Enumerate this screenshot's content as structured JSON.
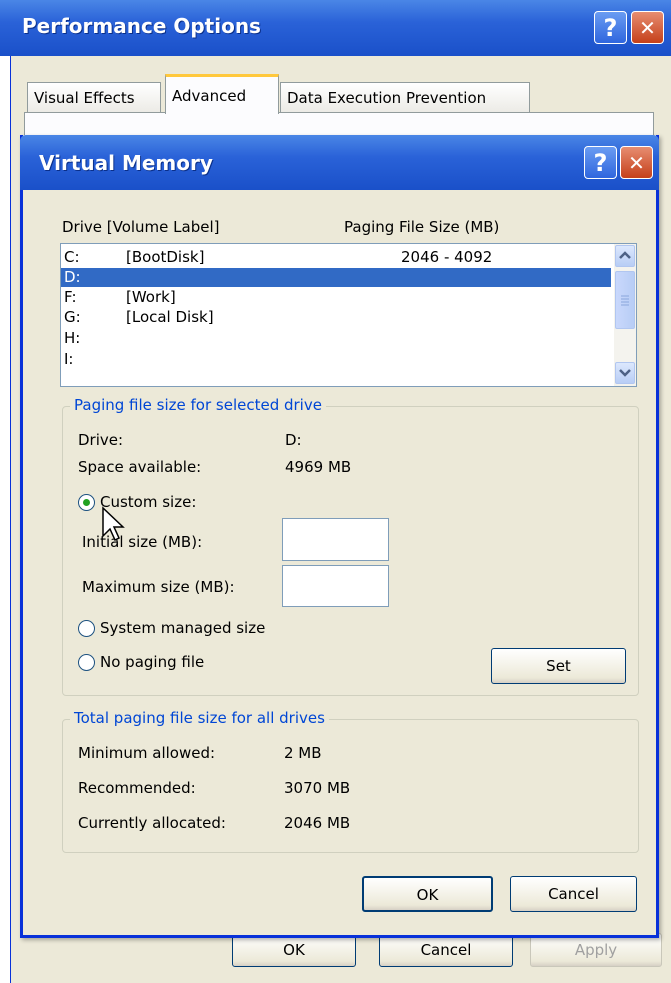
{
  "perf": {
    "title": "Performance Options",
    "help_glyph": "?",
    "close_glyph": "✕",
    "tabs": [
      {
        "label": "Visual Effects",
        "active": false
      },
      {
        "label": "Advanced",
        "active": true
      },
      {
        "label": "Data Execution Prevention",
        "active": false
      }
    ],
    "buttons": {
      "ok": "OK",
      "cancel": "Cancel",
      "apply": "Apply"
    }
  },
  "vm": {
    "title": "Virtual Memory",
    "help_glyph": "?",
    "close_glyph": "✕",
    "list_headers": {
      "drive": "Drive  [Volume Label]",
      "size": "Paging File Size (MB)"
    },
    "drives": [
      {
        "letter": "C:",
        "label": "[BootDisk]",
        "size": "2046 - 4092",
        "selected": false
      },
      {
        "letter": "D:",
        "label": "",
        "size": "",
        "selected": true
      },
      {
        "letter": "F:",
        "label": "[Work]",
        "size": "",
        "selected": false
      },
      {
        "letter": "G:",
        "label": "[Local Disk]",
        "size": "",
        "selected": false
      },
      {
        "letter": "H:",
        "label": "",
        "size": "",
        "selected": false
      },
      {
        "letter": "I:",
        "label": "",
        "size": "",
        "selected": false
      }
    ],
    "selected_group": {
      "legend": "Paging file size for selected drive",
      "drive_label": "Drive:",
      "drive_value": "D:",
      "space_label": "Space available:",
      "space_value": "4969 MB",
      "custom_label": "Custom size:",
      "initial_label": "Initial size (MB):",
      "initial_value": "",
      "maximum_label": "Maximum size (MB):",
      "maximum_value": "",
      "system_label": "System managed size",
      "nopaging_label": "No paging file",
      "selected_option": "custom",
      "set_button": "Set"
    },
    "total_group": {
      "legend": "Total paging file size for all drives",
      "min_label": "Minimum allowed:",
      "min_value": "2 MB",
      "rec_label": "Recommended:",
      "rec_value": "3070 MB",
      "cur_label": "Currently allocated:",
      "cur_value": "2046 MB"
    },
    "buttons": {
      "ok": "OK",
      "cancel": "Cancel"
    }
  }
}
